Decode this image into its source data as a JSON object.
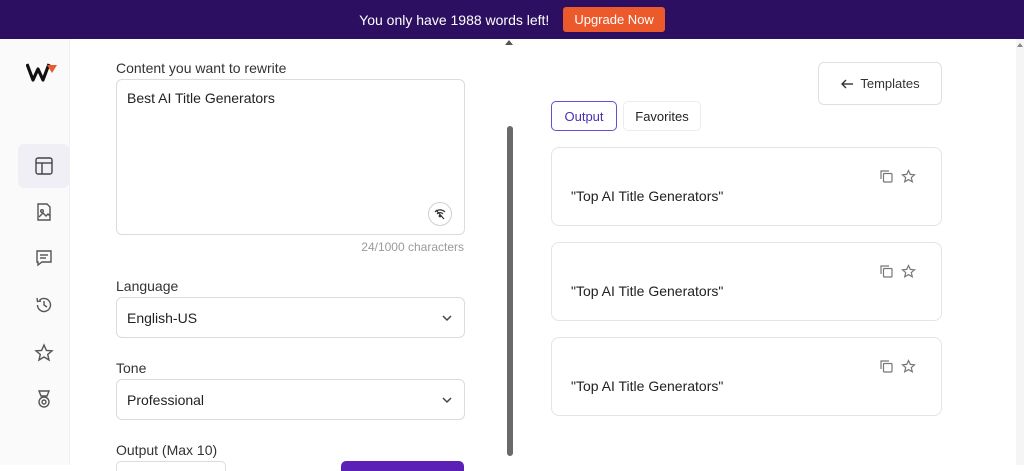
{
  "banner": {
    "message": "You only have 1988 words left!",
    "upgrade_label": "Upgrade Now",
    "bg_color": "#2c0f61",
    "button_color": "#ec5a2c"
  },
  "sidebar": {
    "items": [
      {
        "icon": "layout-icon",
        "active": true
      },
      {
        "icon": "document-image-icon",
        "active": false
      },
      {
        "icon": "chat-icon",
        "active": false
      },
      {
        "icon": "history-icon",
        "active": false
      },
      {
        "icon": "star-icon",
        "active": false
      },
      {
        "icon": "medal-icon",
        "active": false
      }
    ]
  },
  "form": {
    "content_label": "Content you want to rewrite",
    "content_value": "Best AI Title Generators",
    "char_count": "24/1000 characters",
    "language_label": "Language",
    "language_value": "English-US",
    "tone_label": "Tone",
    "tone_value": "Professional",
    "output_label": "Output (Max 10)"
  },
  "results": {
    "templates_label": "Templates",
    "tabs": [
      {
        "label": "Output",
        "active": true
      },
      {
        "label": "Favorites",
        "active": false
      }
    ],
    "items": [
      {
        "text": "\"Top AI Title Generators\""
      },
      {
        "text": "\"Top AI Title Generators\""
      },
      {
        "text": "\"Top AI Title Generators\""
      }
    ],
    "accent_color": "#6d4ad4"
  }
}
